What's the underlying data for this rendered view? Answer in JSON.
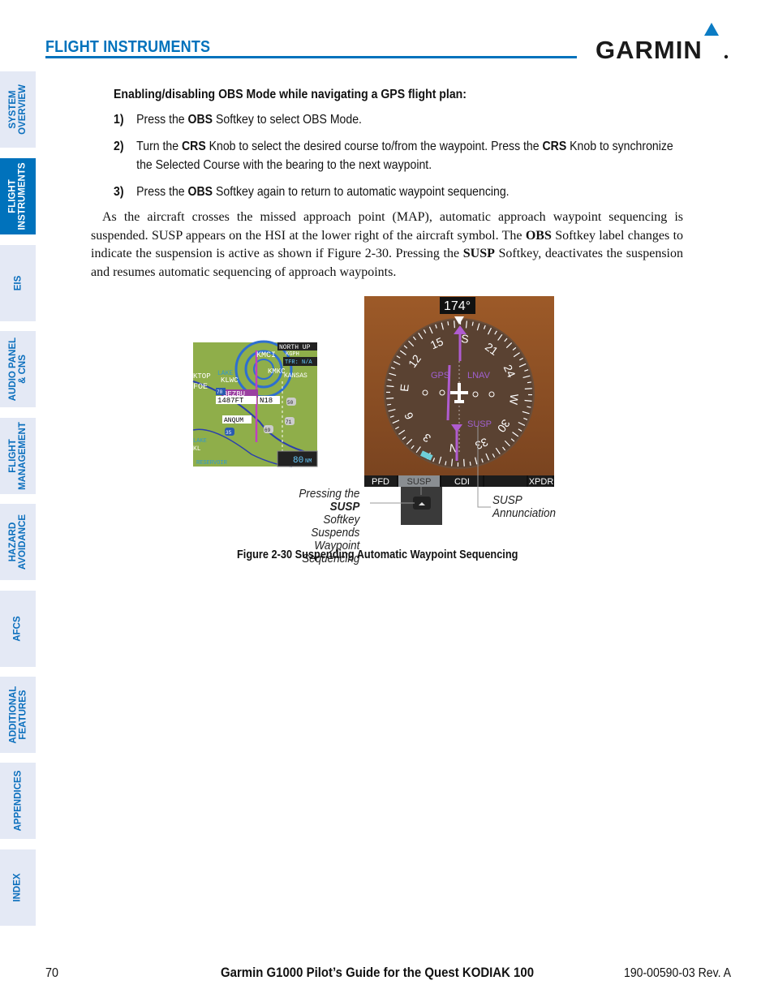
{
  "header": {
    "section_title": "FLIGHT INSTRUMENTS",
    "logo_text": "GARMIN",
    "accent_color": "#0072bc"
  },
  "sidebar": {
    "tabs": [
      {
        "label": [
          "SYSTEM",
          "OVERVIEW"
        ],
        "active": false
      },
      {
        "label": [
          "FLIGHT",
          "INSTRUMENTS"
        ],
        "active": true
      },
      {
        "label": [
          "EIS"
        ],
        "active": false
      },
      {
        "label": [
          "AUDIO PANEL",
          "& CNS"
        ],
        "active": false
      },
      {
        "label": [
          "FLIGHT",
          "MANAGEMENT"
        ],
        "active": false
      },
      {
        "label": [
          "HAZARD",
          "AVOIDANCE"
        ],
        "active": false
      },
      {
        "label": [
          "AFCS"
        ],
        "active": false
      },
      {
        "label": [
          "ADDITIONAL",
          "FEATURES"
        ],
        "active": false
      },
      {
        "label": [
          "APPENDICES"
        ],
        "active": false
      },
      {
        "label": [
          "INDEX"
        ],
        "active": false
      }
    ]
  },
  "content": {
    "heading": "Enabling/disabling OBS Mode while navigating a GPS flight plan:",
    "steps": [
      {
        "num": "1)",
        "segments": [
          {
            "t": "Press the "
          },
          {
            "t": "OBS",
            "b": true
          },
          {
            "t": " Softkey to select OBS Mode."
          }
        ]
      },
      {
        "num": "2)",
        "segments": [
          {
            "t": "Turn the "
          },
          {
            "t": "CRS",
            "b": true
          },
          {
            "t": " Knob to select the desired course to/from the waypoint.  Press the "
          },
          {
            "t": "CRS",
            "b": true
          },
          {
            "t": " Knob to synchronize the Selected Course with the bearing to the next waypoint."
          }
        ]
      },
      {
        "num": "3)",
        "segments": [
          {
            "t": "Press the "
          },
          {
            "t": "OBS",
            "b": true
          },
          {
            "t": " Softkey again to return to automatic waypoint sequencing."
          }
        ]
      }
    ],
    "paragraph": [
      {
        "t": "As the aircraft crosses the missed approach point (MAP), automatic approach waypoint sequencing is suspended.  SUSP appears on the HSI at the lower right of the aircraft symbol.  The "
      },
      {
        "t": "OBS",
        "b": true
      },
      {
        "t": " Softkey label changes to indicate the suspension is active as shown if Figure 2-30.  Pressing the "
      },
      {
        "t": "SUSP",
        "b": true
      },
      {
        "t": " Softkey, deactivates the suspension and resumes automatic sequencing of approach waypoints."
      }
    ]
  },
  "figure": {
    "caption": "Figure 2-30  Suspending Automatic Waypoint Sequencing",
    "map": {
      "orientation": "NORTH UP",
      "tfr": "TFR: N/A",
      "range": "80",
      "range_unit": "NM",
      "labels": [
        "KMCI",
        "KGPH",
        "KMKC",
        "KLWC",
        "KTOP",
        "FOE",
        "LAKE",
        "KANSAS",
        "BEZBU",
        "1487FT",
        "N18",
        "ANQUM",
        "LAKE",
        "KL",
        "RESERVOIR",
        "70",
        "35",
        "50",
        "71",
        "69"
      ]
    },
    "hsi": {
      "heading": "174°",
      "source": "GPS",
      "mode": "LNAV",
      "annunciation": "SUSP",
      "compass": [
        "N",
        "3",
        "6",
        "E",
        "12",
        "15",
        "S",
        "21",
        "24",
        "W",
        "30",
        "33"
      ]
    },
    "softkeys": [
      "PFD",
      "SUSP",
      "CDI",
      "",
      "XPDR"
    ],
    "callout_left": {
      "pre": "Pressing the ",
      "bold": "SUSP",
      "line2": "Softkey Suspends",
      "line3": "Waypoint Sequencing"
    },
    "callout_right": {
      "line1": "SUSP",
      "line2": "Annunciation"
    }
  },
  "footer": {
    "page": "70",
    "title": "Garmin G1000 Pilot’s Guide for the Quest KODIAK 100",
    "doc": "190-00590-03  Rev. A"
  }
}
